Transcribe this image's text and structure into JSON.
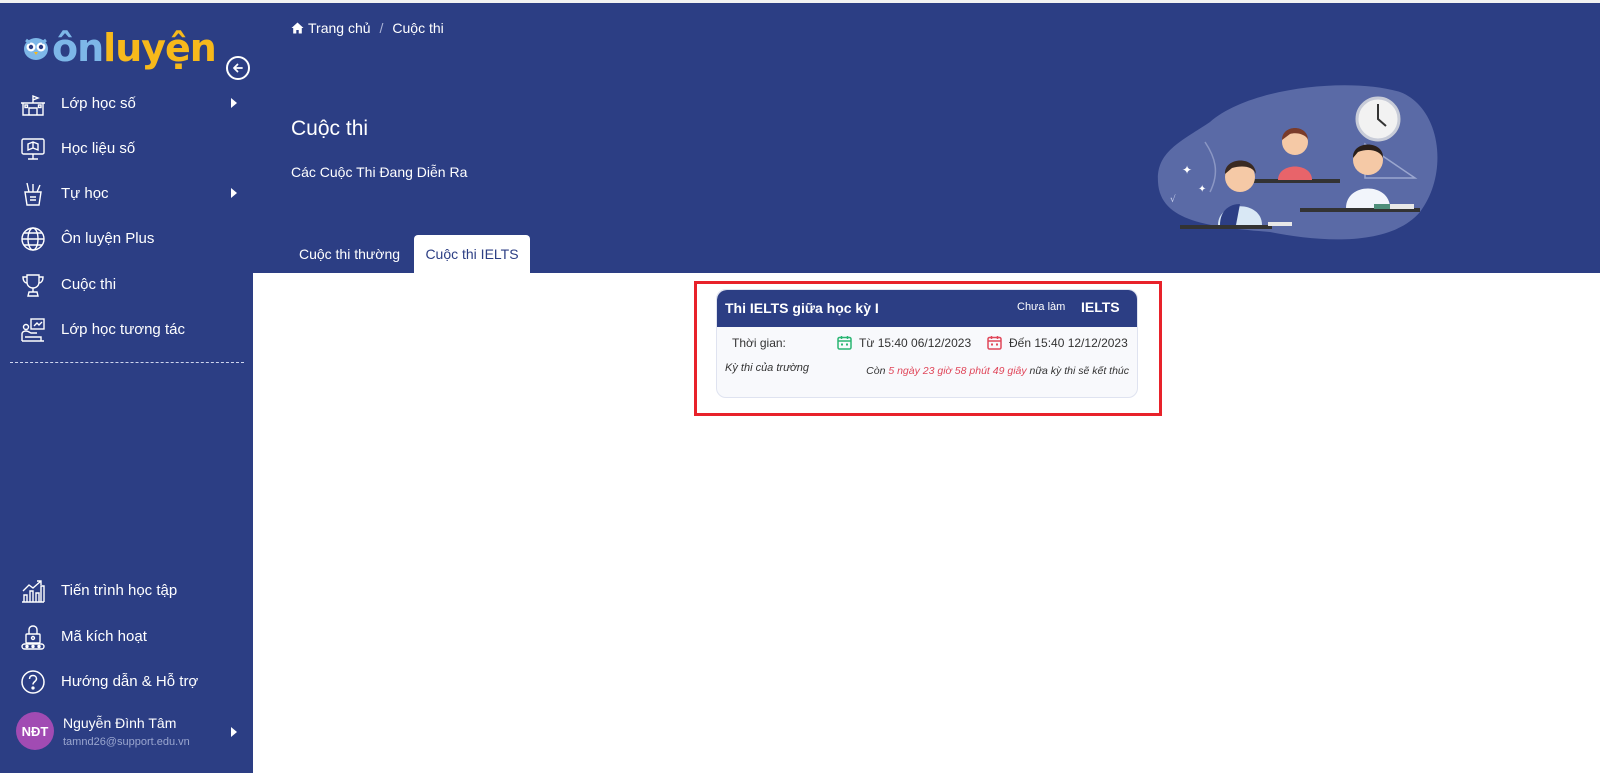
{
  "app": {
    "logo_text_on": "ôn",
    "logo_text_rest": "luyện"
  },
  "sidebar": {
    "items": [
      {
        "label": "Lớp học số",
        "icon": "school-icon",
        "has_arrow": true
      },
      {
        "label": "Học liệu số",
        "icon": "monitor-book-icon",
        "has_arrow": false
      },
      {
        "label": "Tự học",
        "icon": "pencil-cup-icon",
        "has_arrow": true
      },
      {
        "label": "Ôn luyện Plus",
        "icon": "globe-icon",
        "has_arrow": false
      },
      {
        "label": "Cuộc thi",
        "icon": "trophy-icon",
        "has_arrow": false
      },
      {
        "label": "Lớp học tương tác",
        "icon": "interactive-board-icon",
        "has_arrow": false
      }
    ],
    "bottom_items": [
      {
        "label": "Tiến trình học tập",
        "icon": "progress-chart-icon"
      },
      {
        "label": "Mã kích hoạt",
        "icon": "lock-key-icon"
      },
      {
        "label": "Hướng dẫn & Hỗ trợ",
        "icon": "help-icon"
      }
    ],
    "user": {
      "initials": "NĐT",
      "name": "Nguyễn Đình Tâm",
      "email": "tamnd26@support.edu.vn"
    }
  },
  "breadcrumb": {
    "home": "Trang chủ",
    "separator": "/",
    "current": "Cuộc thi"
  },
  "header": {
    "title": "Cuộc thi",
    "subtitle": "Các Cuộc Thi Đang Diễn Ra"
  },
  "tabs": [
    {
      "label": "Cuộc thi thường",
      "active": false
    },
    {
      "label": "Cuộc thi IELTS",
      "active": true
    }
  ],
  "contest_card": {
    "title": "Thi IELTS giữa học kỳ I",
    "status": "Chưa làm",
    "type": "IELTS",
    "time_label": "Thời gian:",
    "from": "Từ 15:40 06/12/2023",
    "to": "Đến 15:40 12/12/2023",
    "scope": "Kỳ thi của trường",
    "countdown_prefix": "Còn",
    "countdown_value": "5 ngày 23 giờ 58 phút 49 giây",
    "countdown_suffix": "nữa kỳ thi sẽ kết thúc"
  },
  "colors": {
    "primary": "#2c3e84",
    "logo_yellow": "#f7b91b",
    "highlight_red": "#e8222a",
    "countdown_red": "#e0475a",
    "avatar": "#a14bb3"
  }
}
